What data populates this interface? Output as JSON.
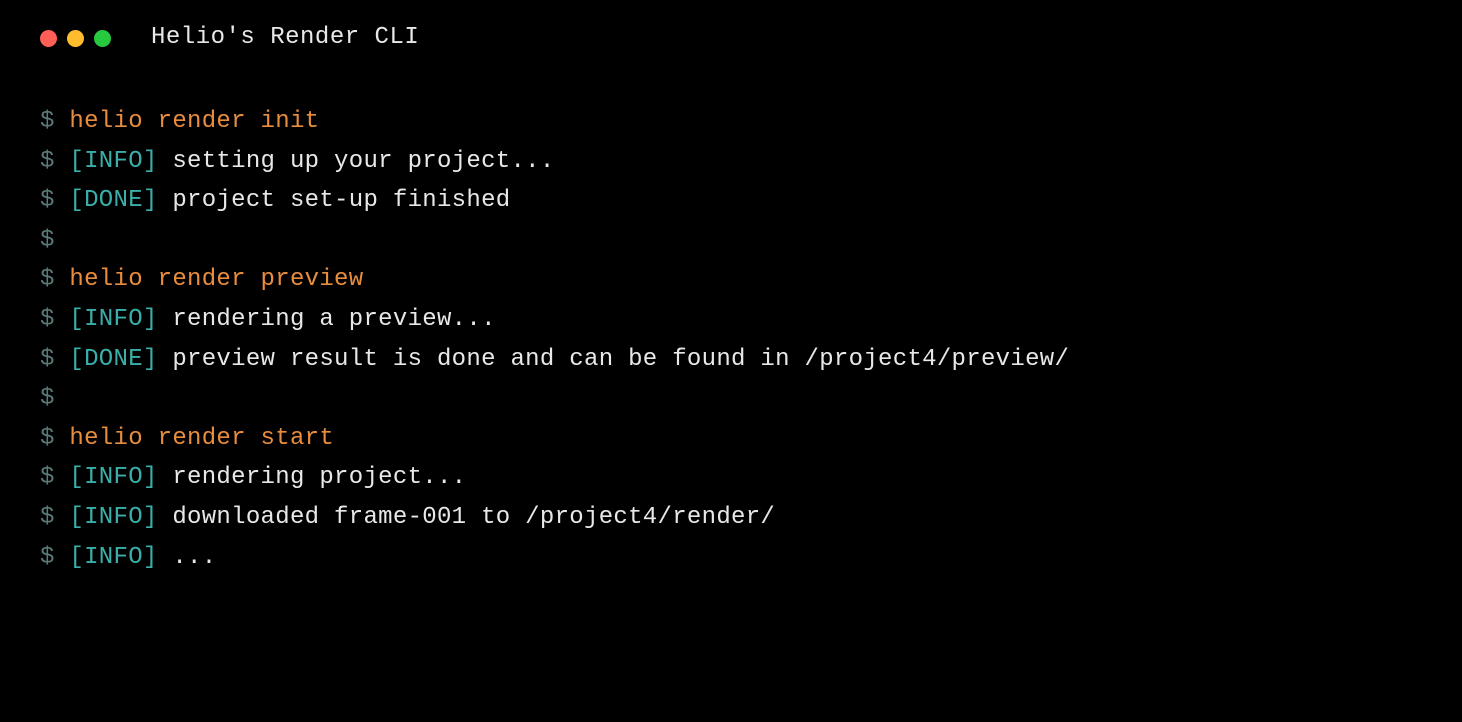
{
  "window": {
    "title": "Helio's Render CLI"
  },
  "prompt": "$",
  "lines": [
    {
      "type": "cmd",
      "text": "helio render init"
    },
    {
      "type": "log",
      "tag": "[INFO]",
      "msg": "setting up your project..."
    },
    {
      "type": "log",
      "tag": "[DONE]",
      "msg": "project set-up finished"
    },
    {
      "type": "blank"
    },
    {
      "type": "cmd",
      "text": "helio render preview"
    },
    {
      "type": "log",
      "tag": "[INFO]",
      "msg": "rendering a preview..."
    },
    {
      "type": "log",
      "tag": "[DONE]",
      "msg": "preview result is done and can be found in /project4/preview/"
    },
    {
      "type": "blank"
    },
    {
      "type": "cmd",
      "text": "helio render start"
    },
    {
      "type": "log",
      "tag": "[INFO]",
      "msg": "rendering project..."
    },
    {
      "type": "log",
      "tag": "[INFO]",
      "msg": "downloaded frame-001 to /project4/render/"
    },
    {
      "type": "log",
      "tag": "[INFO]",
      "msg": "..."
    }
  ]
}
